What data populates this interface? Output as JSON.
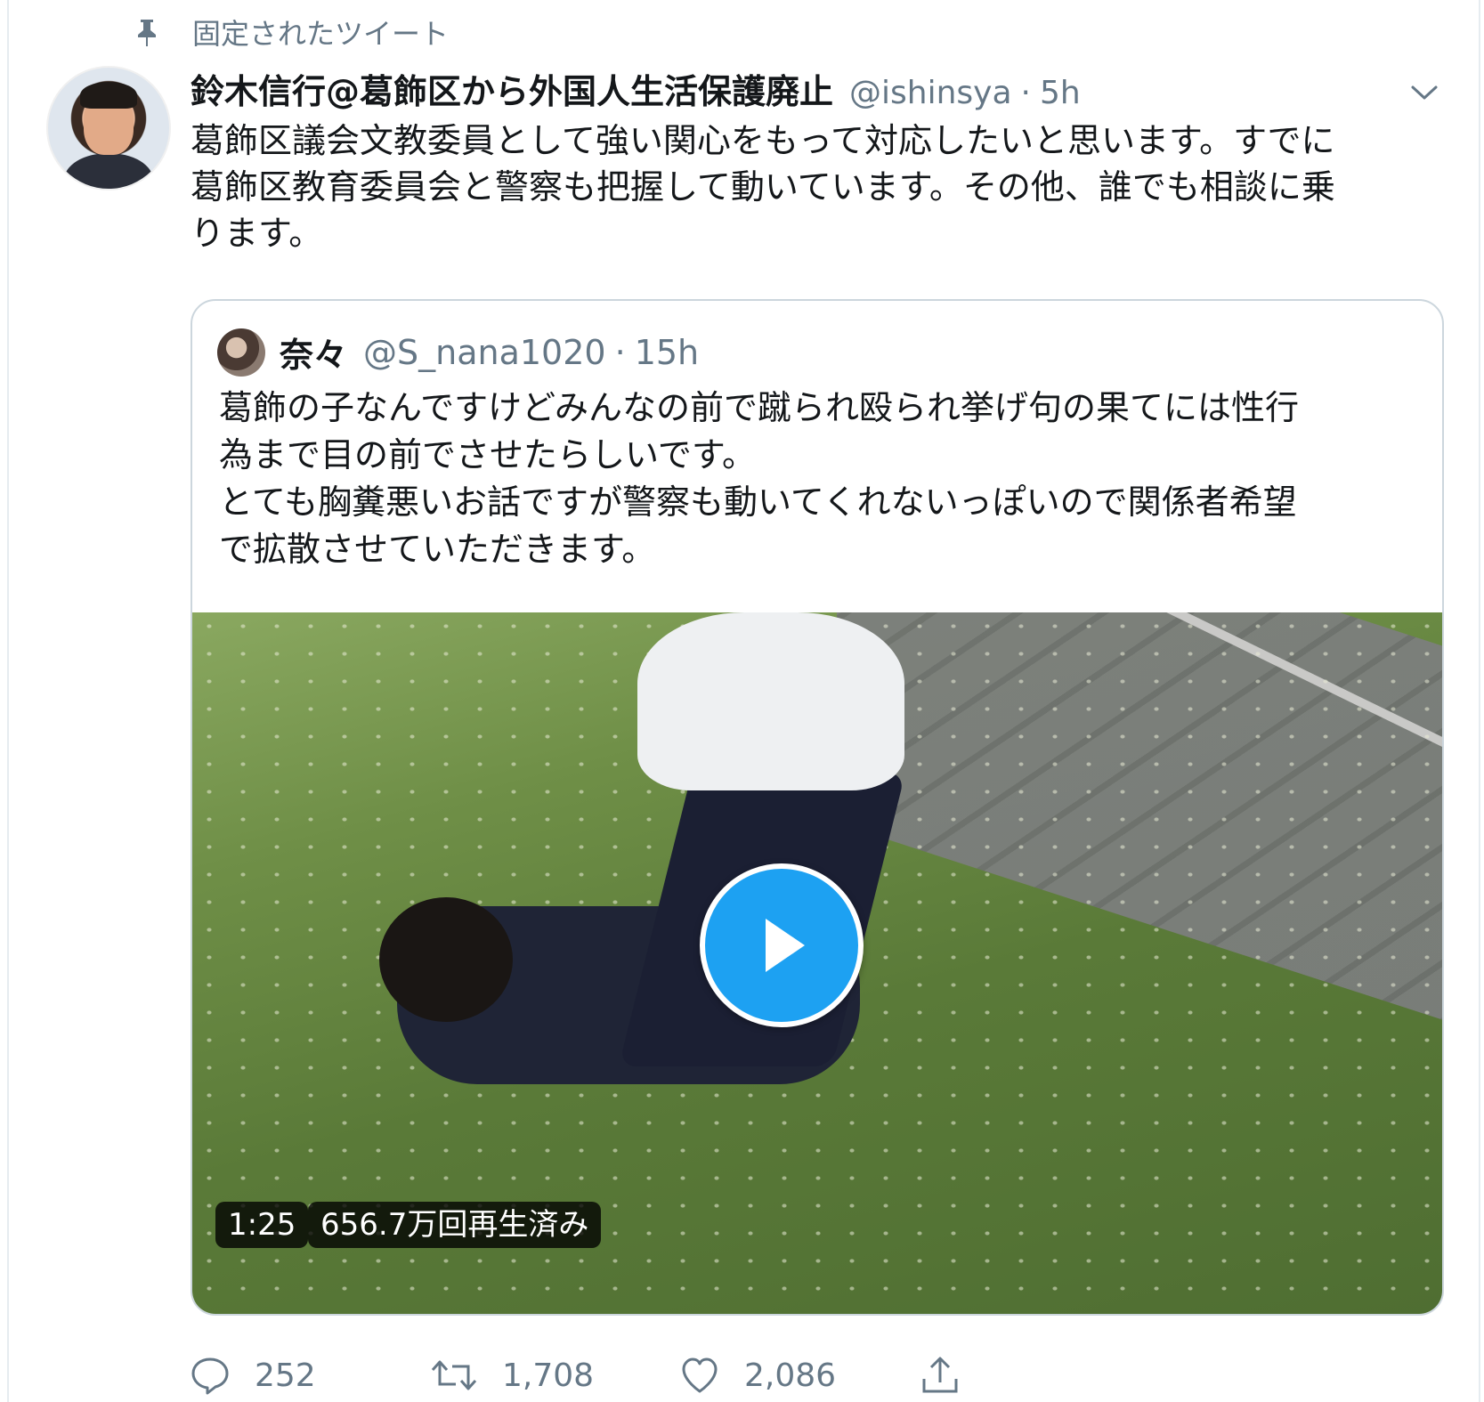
{
  "pinned": {
    "label": "固定されたツイート"
  },
  "tweet": {
    "author_name": "鈴木信行@葛飾区から外国人生活保護廃止",
    "author_handle": "@ishinsya",
    "separator": "·",
    "time": "5h",
    "text": "葛飾区議会文教委員として強い関心をもって対応したいと思います。すでに\n葛飾区教育委員会と警察も把握して動いています。その他、誰でも相談に乗\nります。"
  },
  "quoted_tweet": {
    "author_name": "奈々",
    "author_handle": "@S_nana1020",
    "separator": "·",
    "time": "15h",
    "text": "葛飾の子なんですけどみんなの前で蹴られ殴られ挙げ句の果てには性行\n為まで目の前でさせたらしいです。\nとても胸糞悪いお話ですが警察も動いてくれないっぽいので関係者希望\nで拡散させていただきます。",
    "video": {
      "duration": "1:25",
      "views": "656.7万回再生済み"
    }
  },
  "actions": {
    "reply_count": "252",
    "retweet_count": "1,708",
    "like_count": "2,086"
  },
  "colors": {
    "accent": "#1da1f2",
    "secondary_text": "#657786",
    "border": "#ccd6dd"
  }
}
